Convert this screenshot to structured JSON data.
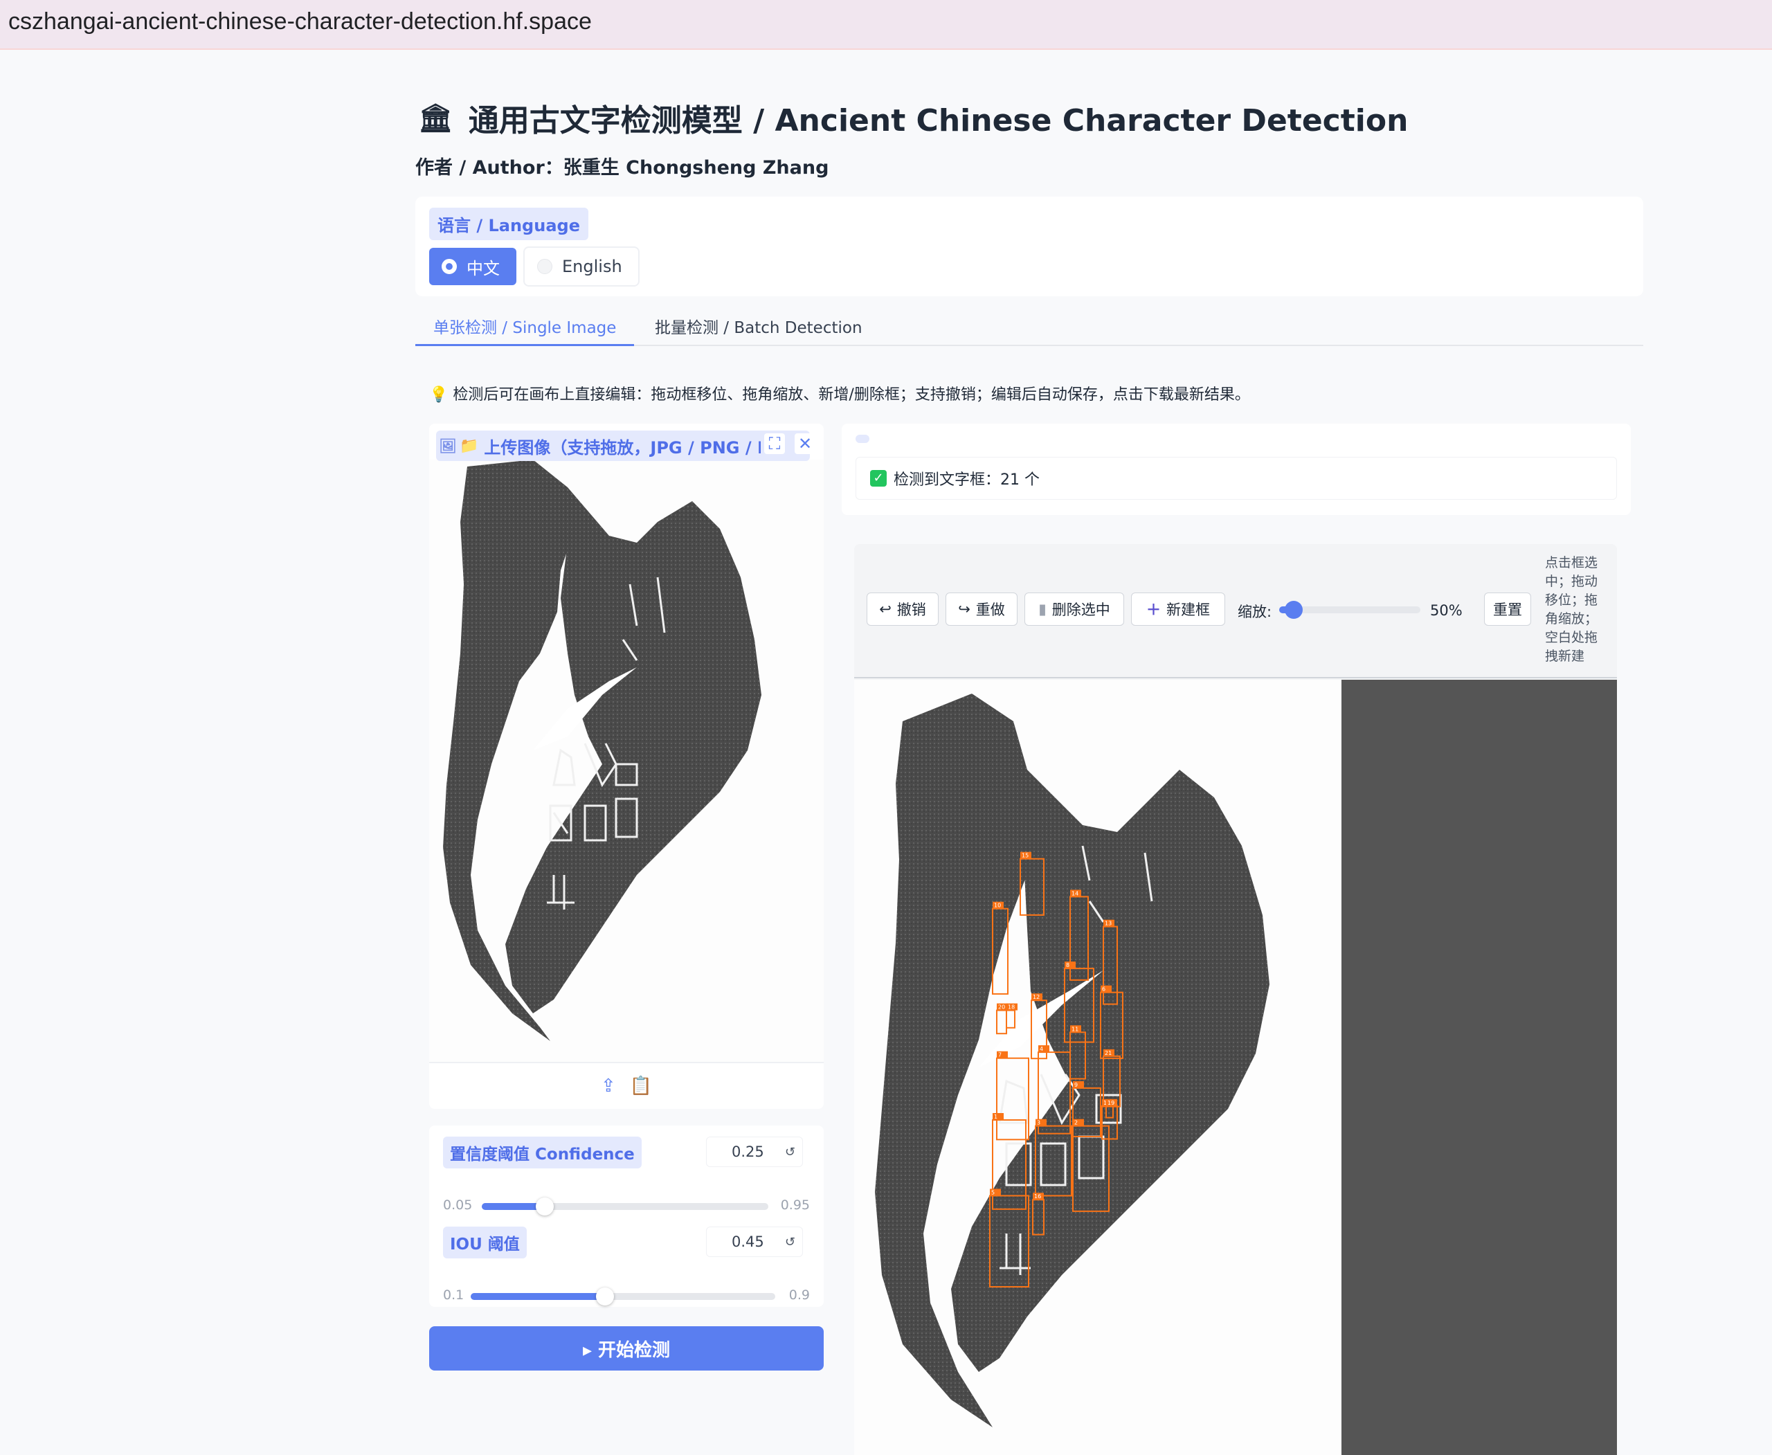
{
  "browser": {
    "url": "cszhangai-ancient-chinese-character-detection.hf.space"
  },
  "header": {
    "icon": "classical-building-icon",
    "title": "通用古文字检测模型  /  Ancient Chinese Character Detection",
    "author": "作者 / Author：张重生  Chongsheng Zhang"
  },
  "language": {
    "label": "语言 / Language",
    "options": [
      "中文",
      "English"
    ],
    "selected": "中文"
  },
  "tabs": [
    {
      "label": "单张检测 / Single Image",
      "active": true
    },
    {
      "label": "批量检测 / Batch Detection",
      "active": false
    }
  ],
  "tip": {
    "icon": "lightbulb-icon",
    "text": "检测后可在画布上直接编辑：拖动框移位、拖角缩放、新增/删除框；支持撤销；编辑后自动保存，点击下载最新结果。"
  },
  "upload": {
    "label": "上传图像（支持拖放，JPG / PNG / BMP",
    "icons": [
      "image-icon",
      "folder-icon",
      "fullscreen-icon",
      "close-icon",
      "upload-icon",
      "paste-icon"
    ]
  },
  "confidence": {
    "label": "置信度阈值 Confidence",
    "value": "0.25",
    "min": "0.05",
    "max": "0.95",
    "fraction": 0.22
  },
  "iou": {
    "label": "IOU 阈值",
    "value": "0.45",
    "min": "0.1",
    "max": "0.9",
    "fraction": 0.44
  },
  "run_button": "▸ 开始检测",
  "result": {
    "text": "检测到文字框：21 个"
  },
  "editor": {
    "undo": "撤销",
    "redo": "重做",
    "delete_selected": "删除选中",
    "new_box": "新建框",
    "zoom_label": "缩放:",
    "zoom_value": "50%",
    "zoom_fraction": 0.05,
    "reset": "重置",
    "hint": "点击框选中；拖动移位；拖角缩放；空白处拖拽新建",
    "box_color": "#f97316",
    "box_labels": [
      "15",
      "14",
      "10",
      "13",
      "8",
      "6",
      "12",
      "20",
      "18",
      "11",
      "21",
      "4",
      "7",
      "9",
      "17",
      "1",
      "3",
      "2",
      "5",
      "16",
      "19"
    ]
  },
  "colors": {
    "accent": "#5a7ef0",
    "accent_light": "#e4e9fd",
    "success": "#22c55e"
  }
}
